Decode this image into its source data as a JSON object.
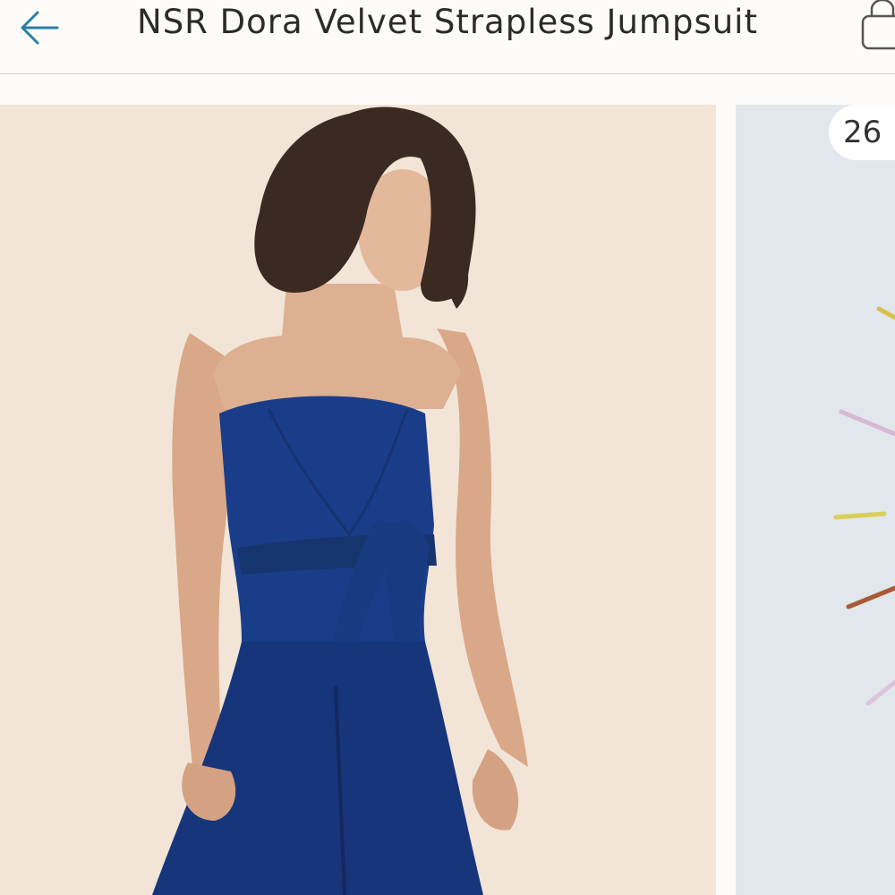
{
  "header": {
    "title": "NSR Dora Velvet Strapless Jumpsuit",
    "back_icon": "arrow-left-icon",
    "bag_icon": "shopping-bag-icon",
    "accent_color": "#2a7fa8"
  },
  "gallery": {
    "current_photo_alt": "Model in blue velvet strapless jumpsuit with tie waist",
    "next_photo_alt": "Illustration with colored strokes",
    "counter_text": "26"
  }
}
